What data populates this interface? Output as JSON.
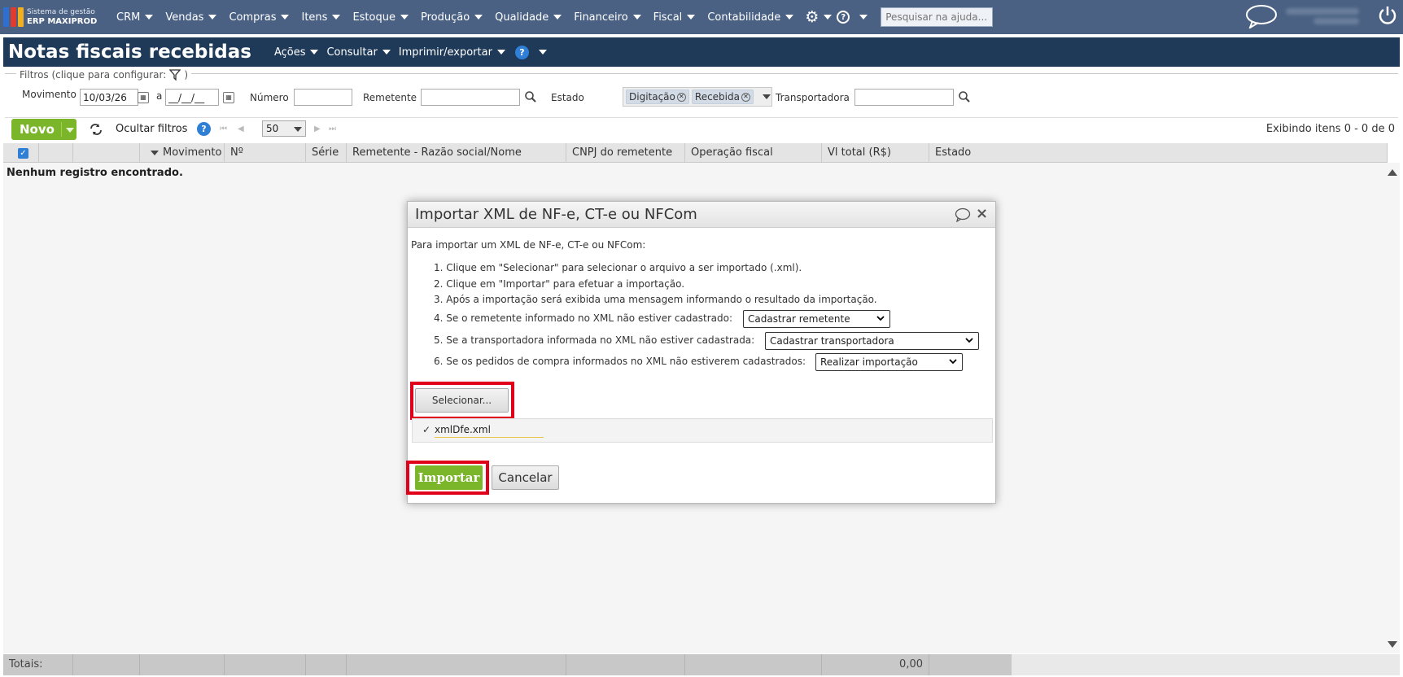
{
  "topbar": {
    "logo_line1": "Sistema de gestão",
    "logo_line2": "ERP MAXIPROD",
    "menu": [
      "CRM",
      "Vendas",
      "Compras",
      "Itens",
      "Estoque",
      "Produção",
      "Qualidade",
      "Financeiro",
      "Fiscal",
      "Contabilidade"
    ],
    "help_placeholder": "Pesquisar na ajuda...",
    "help_glyph": "?"
  },
  "page": {
    "title": "Notas fiscais recebidas",
    "menus": [
      "Ações",
      "Consultar",
      "Imprimir/exportar"
    ],
    "help_glyph": "?"
  },
  "filters": {
    "legend": "Filtros (clique para configurar:",
    "legend_end": ")",
    "movimento_label": "Movimento",
    "movimento_from": "10/03/26",
    "a_label": "a",
    "movimento_to": "__/__/__",
    "numero_label": "Número",
    "remetente_label": "Remetente",
    "estado_label": "Estado",
    "estado_chips": [
      "Digitação",
      "Recebida"
    ],
    "transportadora_label": "Transportadora"
  },
  "toolbar": {
    "novo_label": "Novo",
    "ocultar_filtros": "Ocultar filtros",
    "page_size": "50",
    "showing": "Exibindo itens 0 - 0 de 0"
  },
  "grid": {
    "columns": [
      "Movimento",
      "Nº",
      "Série",
      "Remetente - Razão social/Nome",
      "CNPJ do remetente",
      "Operação fiscal",
      "Vl total (R$)",
      "Estado"
    ],
    "empty_message": "Nenhum registro encontrado.",
    "totals_label": "Totais:",
    "total_value": "0,00"
  },
  "dialog": {
    "title": "Importar XML de NF-e, CT-e ou NFCom",
    "intro": "Para importar um XML de NF-e, CT-e ou NFCom:",
    "step1": "1. Clique em \"Selecionar\" para selecionar o arquivo a ser importado (.xml).",
    "step2": "2. Clique em \"Importar\" para efetuar a importação.",
    "step3": "3. Após a importação será exibida uma mensagem informando o resultado da importação.",
    "step4": "4. Se o remetente informado no XML não estiver cadastrado:",
    "step4_select": "Cadastrar remetente",
    "step5": "5. Se a transportadora informada no XML não estiver cadastrada:",
    "step5_select": "Cadastrar transportadora",
    "step6": "6. Se os pedidos de compra informados no XML não estiverem cadastrados:",
    "step6_select": "Realizar importação",
    "selecionar_label": "Selecionar...",
    "file_check": "✓",
    "file_name": "xmlDfe.xml",
    "importar_label": "Importar",
    "cancelar_label": "Cancelar",
    "close_glyph": "×"
  },
  "colors": {
    "topbar": "#4a6183",
    "page_header": "#1f3a58",
    "accent_green": "#7ab52a",
    "highlight_red": "#e0001a"
  }
}
